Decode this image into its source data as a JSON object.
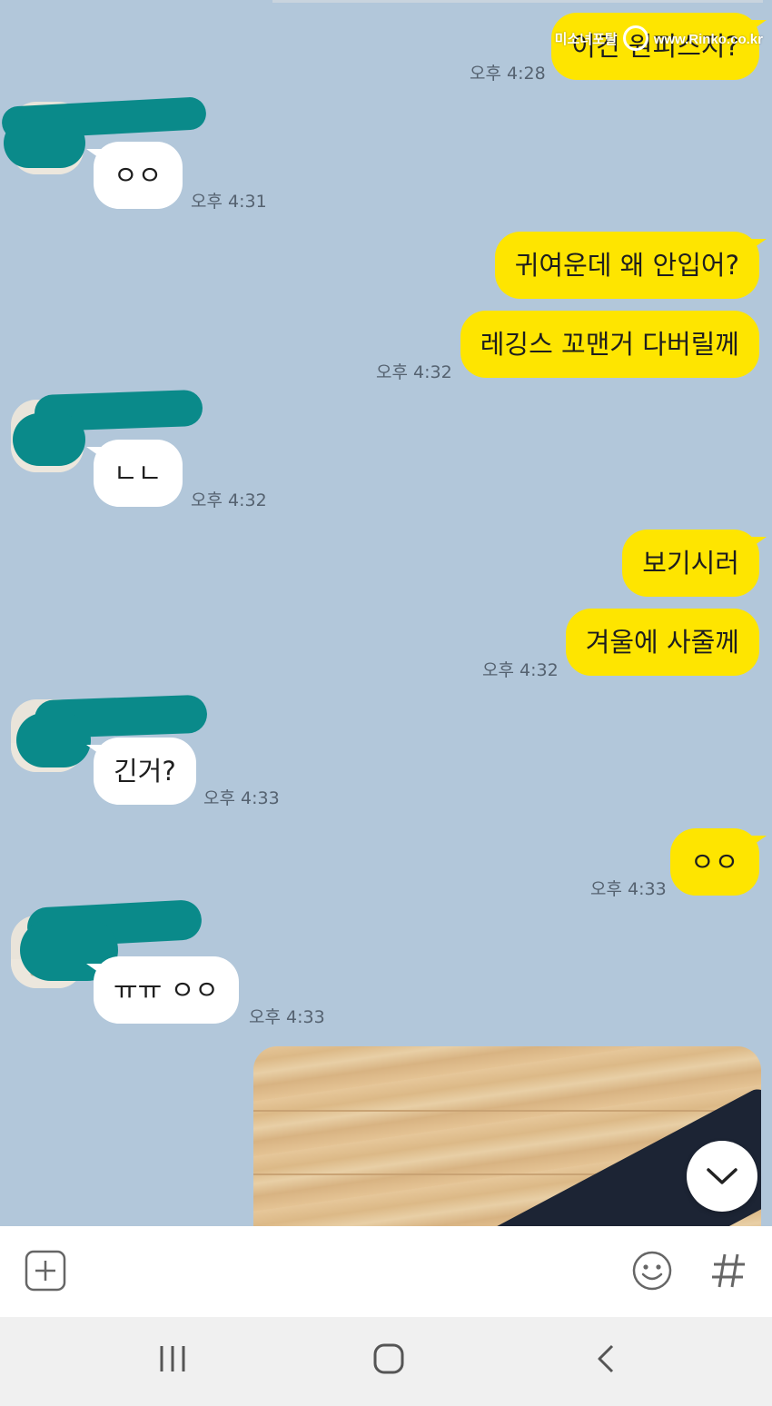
{
  "watermark": {
    "text": "미소녀포탈",
    "url": "www.Rinko.co.kr"
  },
  "messages": [
    {
      "sender": "me",
      "text": "이건 원피스지?",
      "time": "오후 4:28"
    },
    {
      "sender": "other",
      "text": "ㅇㅇ",
      "time": "오후 4:31"
    },
    {
      "sender": "me",
      "text": "귀여운데 왜 안입어?"
    },
    {
      "sender": "me",
      "text": "레깅스 꼬맨거 다버릴께",
      "time": "오후 4:32"
    },
    {
      "sender": "other",
      "text": "ㄴㄴ",
      "time": "오후 4:32"
    },
    {
      "sender": "me",
      "text": "보기시러"
    },
    {
      "sender": "me",
      "text": "겨울에 사줄께",
      "time": "오후 4:32"
    },
    {
      "sender": "other",
      "text": "긴거?",
      "time": "오후 4:33"
    },
    {
      "sender": "me",
      "text": "ㅇㅇ",
      "time": "오후 4:33"
    },
    {
      "sender": "other",
      "text": "ㅠㅠ ㅇㅇ",
      "time": "오후 4:33"
    }
  ],
  "input_bar": {
    "icons": [
      "plus-box-icon",
      "emoji-icon",
      "hashtag-icon"
    ]
  },
  "scroll_button": {
    "icon": "chevron-down-icon"
  },
  "nav_bar": {
    "icons": [
      "recent-apps-icon",
      "home-icon",
      "back-icon"
    ]
  },
  "colors": {
    "background": "#b2c7da",
    "my_bubble": "#fee500",
    "other_bubble": "#ffffff",
    "avatar_scribble": "#0a8a8a"
  }
}
